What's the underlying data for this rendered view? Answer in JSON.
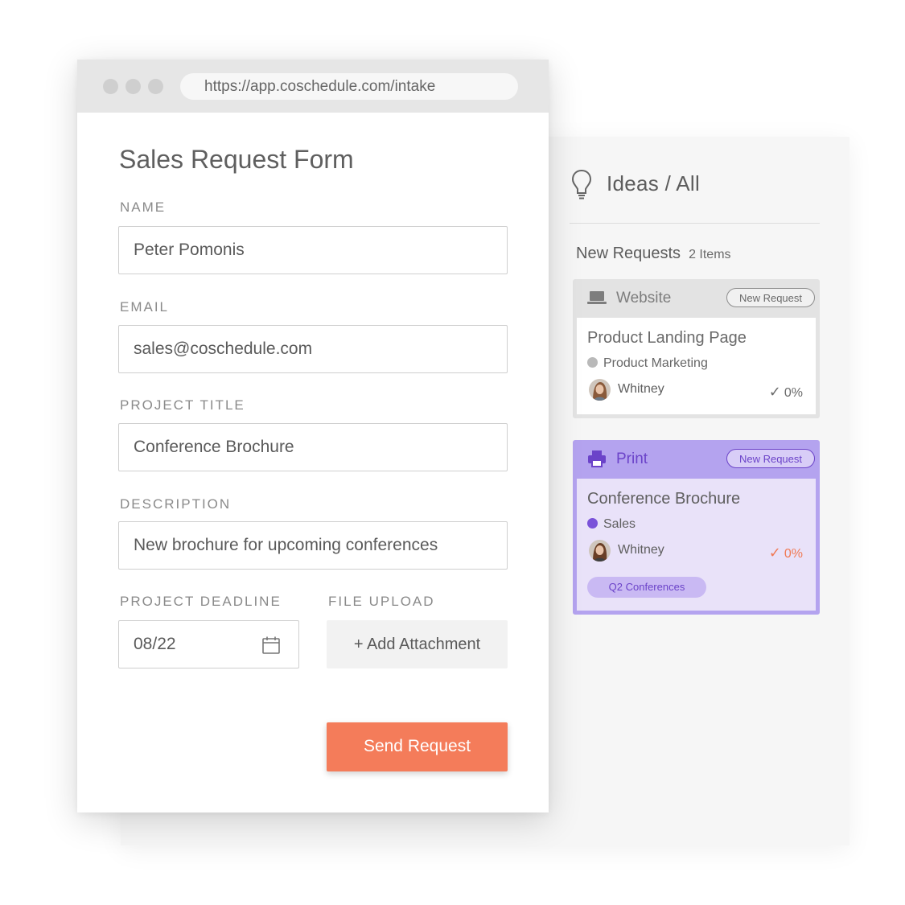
{
  "browser": {
    "url": "https://app.coschedule.com/intake"
  },
  "form": {
    "title": "Sales Request Form",
    "name_label": "NAME",
    "name_value": "Peter Pomonis",
    "email_label": "EMAIL",
    "email_value": "sales@coschedule.com",
    "project_title_label": "PROJECT TITLE",
    "project_title_value": "Conference Brochure",
    "description_label": "DESCRIPTION",
    "description_value": "New brochure for upcoming conferences",
    "deadline_label": "PROJECT DEADLINE",
    "deadline_value": "08/22",
    "upload_label": "FILE UPLOAD",
    "add_attachment_label": "+ Add Attachment",
    "send_label": "Send Request"
  },
  "board": {
    "title": "Ideas / All",
    "section_title": "New Requests",
    "section_count": "2 Items",
    "cards": [
      {
        "type": "Website",
        "type_icon": "laptop-icon",
        "badge": "New Request",
        "title": "Product Landing Page",
        "department": "Product Marketing",
        "department_color": "#b9b9b9",
        "owner": "Whitney",
        "progress": "0%"
      },
      {
        "type": "Print",
        "type_icon": "printer-icon",
        "badge": "New Request",
        "title": "Conference Brochure",
        "department": "Sales",
        "department_color": "#7a52d9",
        "owner": "Whitney",
        "progress": "0%",
        "tag": "Q2 Conferences"
      }
    ]
  },
  "colors": {
    "accent": "#f47c5a",
    "print_purple": "#6b43c9"
  }
}
